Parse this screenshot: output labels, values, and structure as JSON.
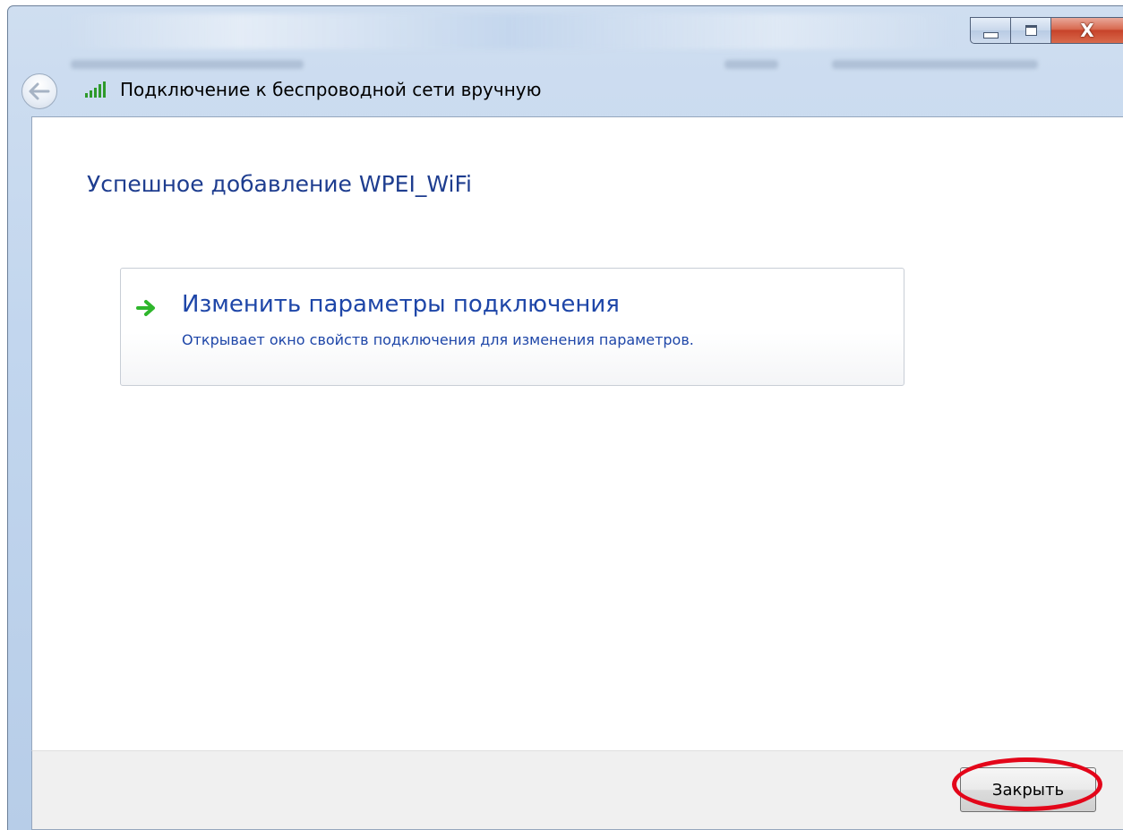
{
  "window": {
    "title": "Подключение к беспроводной сети вручную",
    "controls": {
      "minimize_icon": "minimize-icon",
      "maximize_icon": "maximize-icon",
      "close_glyph": "X"
    }
  },
  "header": {
    "back_icon": "back-arrow-icon",
    "network_icon": "wifi-signal-icon",
    "title": "Подключение к беспроводной сети вручную"
  },
  "content": {
    "heading": "Успешное добавление WPEI_WiFi",
    "option": {
      "icon": "green-arrow-icon",
      "title": "Изменить параметры подключения",
      "description": "Открывает окно свойств подключения для изменения параметров."
    }
  },
  "footer": {
    "close_label": "Закрыть"
  },
  "colors": {
    "heading": "#1e3d8f",
    "link": "#1e46a8",
    "highlight": "#e3061a",
    "arrow": "#2fb62c"
  }
}
